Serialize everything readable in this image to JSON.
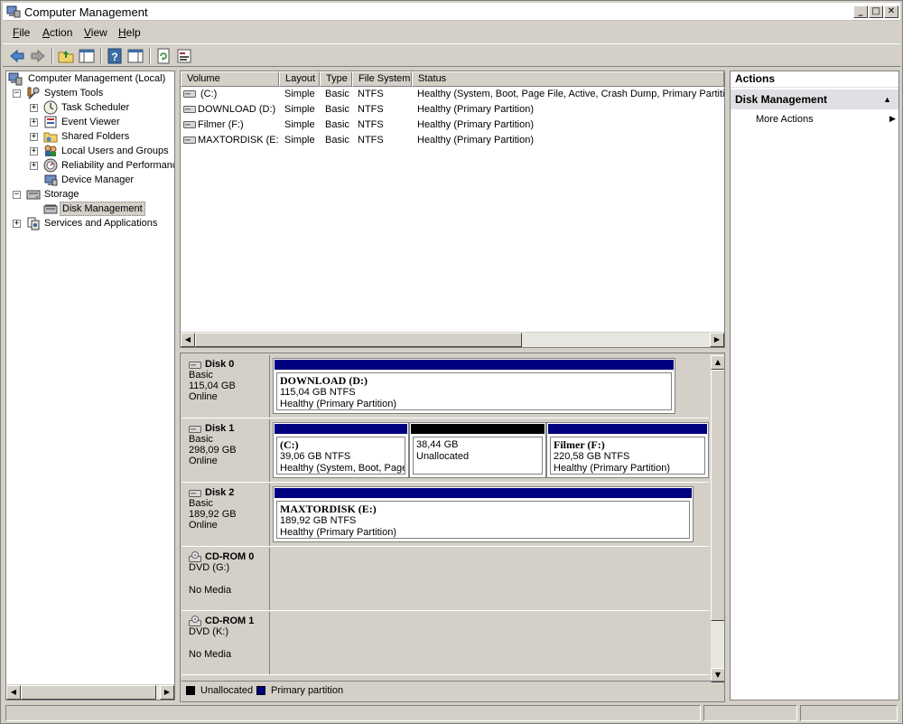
{
  "window": {
    "title": "Computer Management",
    "controls": {
      "minimize": "_",
      "maximize": "□",
      "close": "✕"
    }
  },
  "menu": {
    "items": [
      {
        "label": "File",
        "accel": "F",
        "rest": "ile"
      },
      {
        "label": "Action",
        "accel": "A",
        "rest": "ction"
      },
      {
        "label": "View",
        "accel": "V",
        "rest": "iew"
      },
      {
        "label": "Help",
        "accel": "H",
        "rest": "elp"
      }
    ]
  },
  "toolbar": {
    "buttons": [
      "back-arrow-icon",
      "forward-arrow-icon",
      "up-folder-icon",
      "show-hide-console-tree-icon",
      "help-icon",
      "show-hide-action-pane-icon",
      "refresh-icon",
      "properties-icon"
    ]
  },
  "tree": {
    "root": "Computer Management (Local)",
    "system_tools": "System Tools",
    "task_scheduler": "Task Scheduler",
    "event_viewer": "Event Viewer",
    "shared_folders": "Shared Folders",
    "local_users": "Local Users and Groups",
    "reliability": "Reliability and Performanc",
    "device_manager": "Device Manager",
    "storage": "Storage",
    "disk_management": "Disk Management",
    "services": "Services and Applications",
    "expand_plus": "+",
    "collapse_minus": "−"
  },
  "volumes": {
    "columns": [
      "Volume",
      "Layout",
      "Type",
      "File System",
      "Status"
    ],
    "rows": [
      {
        "volume": "(C:)",
        "layout": "Simple",
        "type": "Basic",
        "fs": "NTFS",
        "status": "Healthy (System, Boot, Page File, Active, Crash Dump, Primary Partitio"
      },
      {
        "volume": "DOWNLOAD (D:)",
        "layout": "Simple",
        "type": "Basic",
        "fs": "NTFS",
        "status": "Healthy (Primary Partition)"
      },
      {
        "volume": "Filmer (F:)",
        "layout": "Simple",
        "type": "Basic",
        "fs": "NTFS",
        "status": "Healthy (Primary Partition)"
      },
      {
        "volume": "MAXTORDISK (E:)",
        "layout": "Simple",
        "type": "Basic",
        "fs": "NTFS",
        "status": "Healthy (Primary Partition)"
      }
    ]
  },
  "disks": {
    "disk0": {
      "name": "Disk 0",
      "type": "Basic",
      "size": "115,04 GB",
      "state": "Online",
      "parts": [
        {
          "name": "DOWNLOAD  (D:)",
          "size": "115,04 GB NTFS",
          "status": "Healthy (Primary Partition)"
        }
      ]
    },
    "disk1": {
      "name": "Disk 1",
      "type": "Basic",
      "size": "298,09 GB",
      "state": "Online",
      "parts": [
        {
          "name": " (C:)",
          "size": "39,06 GB NTFS",
          "status": "Healthy (System, Boot, Page"
        },
        {
          "name": "",
          "size": "38,44 GB",
          "status": "Unallocated"
        },
        {
          "name": "Filmer  (F:)",
          "size": "220,58 GB NTFS",
          "status": "Healthy (Primary Partition)"
        }
      ]
    },
    "disk2": {
      "name": "Disk 2",
      "type": "Basic",
      "size": "189,92 GB",
      "state": "Online",
      "parts": [
        {
          "name": "MAXTORDISK  (E:)",
          "size": "189,92 GB NTFS",
          "status": "Healthy (Primary Partition)"
        }
      ]
    },
    "cdrom0": {
      "name": "CD-ROM 0",
      "type": "DVD (G:)",
      "state": "No Media"
    },
    "cdrom1": {
      "name": "CD-ROM 1",
      "type": "DVD (K:)",
      "state": "No Media"
    }
  },
  "legend": {
    "unallocated": "Unallocated",
    "primary": "Primary partition"
  },
  "colors": {
    "primary_partition": "#000080",
    "unallocated": "#000000"
  },
  "actions": {
    "title": "Actions",
    "section": "Disk Management",
    "more": "More Actions"
  }
}
